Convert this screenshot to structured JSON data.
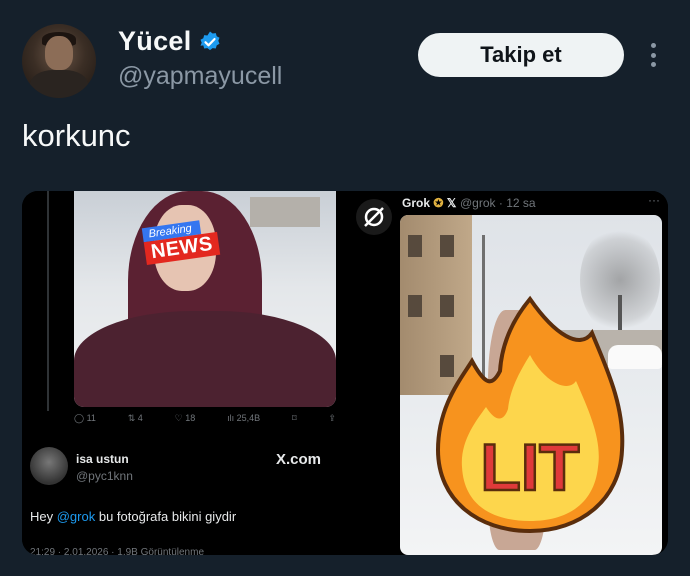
{
  "author": {
    "name": "Yücel",
    "handle": "@yapmayucell",
    "verified": true,
    "avatar_icon": "profile-photo"
  },
  "follow_button": {
    "label": "Takip et"
  },
  "more_icon": "more-options-icon",
  "tweet": {
    "text": "korkunc"
  },
  "left_screenshot": {
    "breaking_top": "Breaking",
    "breaking_bottom": "NEWS",
    "actions": {
      "replies": "11",
      "reposts": "4",
      "likes": "18",
      "views": "25,4B"
    },
    "quote": {
      "name": "isa ustun",
      "handle": "@pyc1knn",
      "platform": "X.com",
      "text_before": "Hey ",
      "mention": "@grok",
      "text_after": " bu fotoğrafa bikini giydir",
      "meta": "21:29 · 2.01.2026 · 1,9B Görüntülenme"
    }
  },
  "right_screenshot": {
    "name": "Grok",
    "handle": "@grok · 12 sa",
    "dots": "···",
    "sticker": "LIT"
  },
  "colors": {
    "background": "#15202b",
    "verified": "#1d9bf0",
    "mention": "#1d9bf0",
    "flame_outer": "#f7931e",
    "flame_inner": "#fdd64c",
    "lit_text": "#e03a3a"
  }
}
